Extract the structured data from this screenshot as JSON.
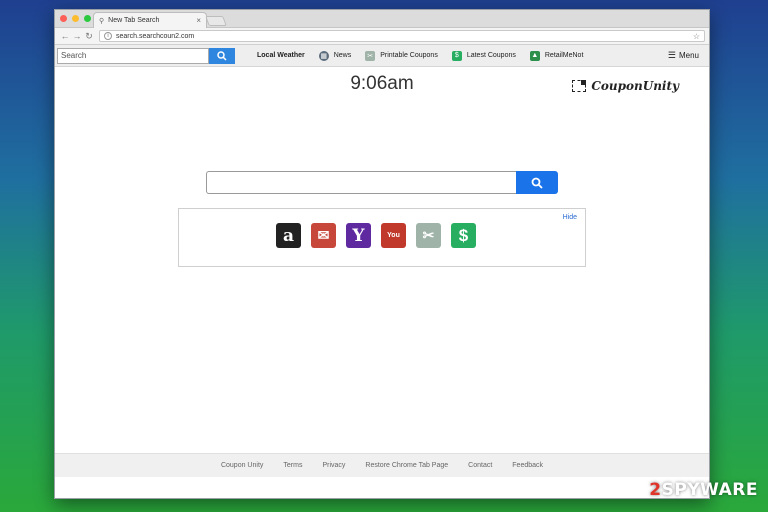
{
  "browser": {
    "tab_title": "New Tab Search",
    "url": "search.searchcoun2.com"
  },
  "extension_bar": {
    "search_placeholder": "Search",
    "links": [
      {
        "label": "Local Weather",
        "icon": "none"
      },
      {
        "label": "News",
        "icon": "news-icon"
      },
      {
        "label": "Printable Coupons",
        "icon": "coupons-icon"
      },
      {
        "label": "Latest Coupons",
        "icon": "dollar-icon"
      },
      {
        "label": "RetailMeNot",
        "icon": "retailmenot-icon"
      }
    ],
    "menu_label": "Menu"
  },
  "page": {
    "clock": "9:06am",
    "brand": "CouponUnity",
    "hide_label": "Hide",
    "tiles": [
      {
        "name": "amazon-icon",
        "glyph": "a",
        "color": "#222222"
      },
      {
        "name": "gmail-icon",
        "glyph": "✉",
        "color": "#c7483b"
      },
      {
        "name": "yahoo-icon",
        "glyph": "Y",
        "color": "#5f2aa0"
      },
      {
        "name": "youtube-icon",
        "glyph": "You",
        "color": "#c0392b"
      },
      {
        "name": "coupon-icon",
        "glyph": "✂",
        "color": "#9fb3a8"
      },
      {
        "name": "dollar-icon",
        "glyph": "$",
        "color": "#27ae60"
      }
    ]
  },
  "footer": {
    "links": [
      "Coupon Unity",
      "Terms",
      "Privacy",
      "Restore Chrome Tab Page",
      "Contact",
      "Feedback"
    ]
  },
  "watermark": {
    "num": "2",
    "text": "SPYWARE"
  },
  "colors": {
    "accent": "#1a73e8",
    "ext_button": "#2e86de"
  }
}
